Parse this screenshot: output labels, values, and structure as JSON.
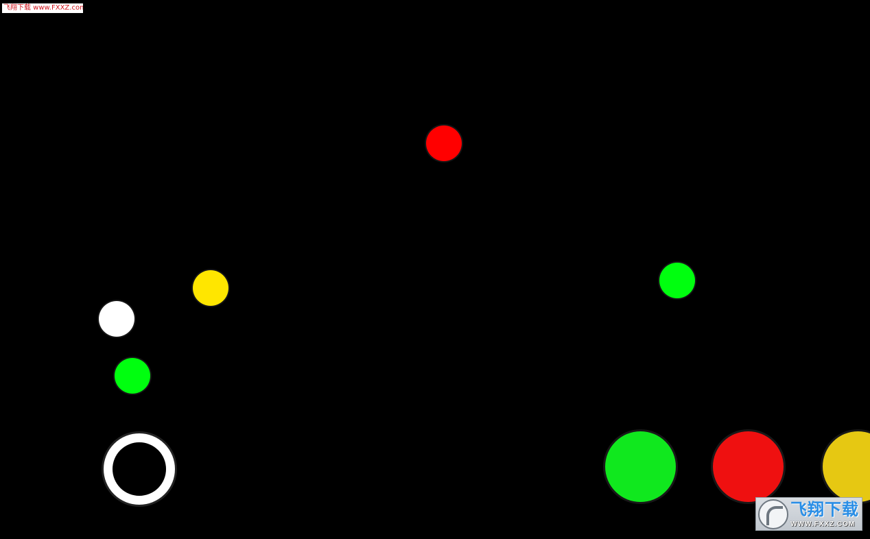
{
  "watermark_top": {
    "text": "飞翔下载 www.FXXZ.com"
  },
  "logo": {
    "cn_text": "飞翔下载",
    "url_text": "WWW.FXXZ.COM",
    "icon": "fxxz-emblem-icon"
  },
  "balls": [
    {
      "name": "red-ball",
      "color": "#ff0000"
    },
    {
      "name": "yellow-ball",
      "color": "#ffe600"
    },
    {
      "name": "white-ball",
      "color": "#ffffff"
    },
    {
      "name": "green-ball",
      "color": "#00ff0f"
    },
    {
      "name": "green-ball",
      "color": "#00ff0f"
    }
  ],
  "player": {
    "name": "player-ring",
    "color": "#ffffff"
  },
  "color_buttons": [
    {
      "name": "green-color-button",
      "color": "#10e81e"
    },
    {
      "name": "red-color-button",
      "color": "#ef1010"
    },
    {
      "name": "yellow-color-button",
      "color": "#e6c812"
    }
  ]
}
